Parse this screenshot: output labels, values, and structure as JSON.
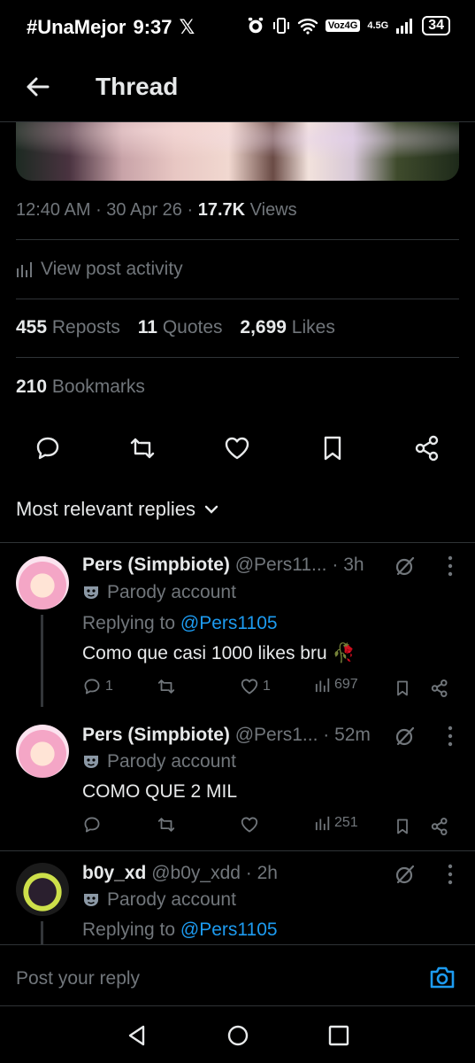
{
  "status_bar": {
    "carrier_text": "#UnaMejor",
    "time": "9:37",
    "x_logo": "𝕏",
    "network_label": "Voz4G",
    "signal_label": "4.5G",
    "battery": "34"
  },
  "header": {
    "title": "Thread"
  },
  "post": {
    "time": "12:40 AM",
    "date": "30 Apr 26",
    "views_count": "17.7K",
    "views_label": "Views",
    "activity_label": "View post activity",
    "reposts_count": "455",
    "reposts_label": "Reposts",
    "quotes_count": "11",
    "quotes_label": "Quotes",
    "likes_count": "2,699",
    "likes_label": "Likes",
    "bookmarks_count": "210",
    "bookmarks_label": "Bookmarks"
  },
  "sort": {
    "label": "Most relevant replies"
  },
  "replies": [
    {
      "name": "Pers (Simpbiote)",
      "handle": "@Pers11...",
      "time": "· 3h",
      "parody": "Parody account",
      "replying_prefix": "Replying to",
      "replying_to": "@Pers1105",
      "text": "Como que casi 1000 likes bru 🥀",
      "reply_count": "1",
      "like_count": "1",
      "view_count": "697"
    },
    {
      "name": "Pers (Simpbiote)",
      "handle": "@Pers1...",
      "time": "· 52m",
      "parody": "Parody account",
      "text": "COMO QUE 2 MIL",
      "reply_count": "",
      "like_count": "",
      "view_count": "251"
    },
    {
      "name": "b0y_xd",
      "handle": "@b0y_xdd",
      "time": "· 2h",
      "parody": "Parody account",
      "replying_prefix": "Replying to",
      "replying_to": "@Pers1105"
    }
  ],
  "composer": {
    "placeholder": "Post your reply"
  },
  "icons": {
    "back": "arrow-left-icon",
    "camera": "camera-icon",
    "parody": "mask-icon",
    "grok": "grok-icon"
  },
  "colors": {
    "background": "#000000",
    "text_primary": "#e7e9ea",
    "text_secondary": "#71767b",
    "accent": "#1d9bf0",
    "divider": "#2f3336"
  }
}
